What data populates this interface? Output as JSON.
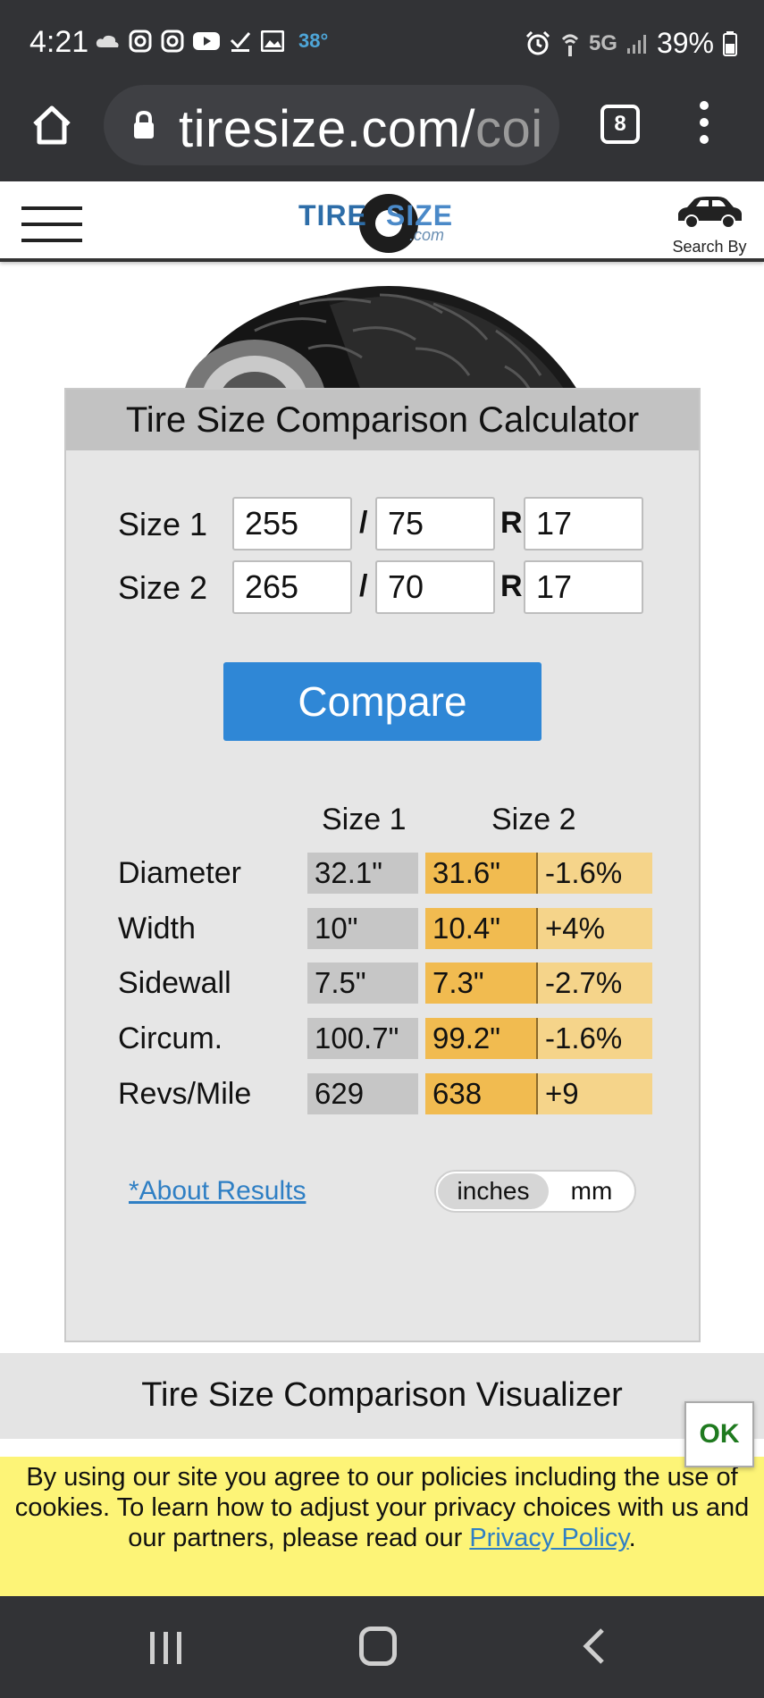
{
  "status_bar": {
    "time": "4:21",
    "temperature": "38°",
    "network": "5G",
    "battery": "39%"
  },
  "browser": {
    "url_main": "tiresize.com/",
    "url_dim": "coi",
    "tab_count": "8"
  },
  "site_header": {
    "logo_left": "TIRE",
    "logo_right": "SIZE",
    "logo_suffix": ".com",
    "search_by": "Search By"
  },
  "calculator": {
    "title": "Tire Size Comparison Calculator",
    "size1": {
      "label": "Size 1",
      "width": "255",
      "ratio": "75",
      "rim": "17"
    },
    "size2": {
      "label": "Size 2",
      "width": "265",
      "ratio": "70",
      "rim": "17"
    },
    "separator": "/",
    "rim_prefix": "R",
    "compare_label": "Compare",
    "results": {
      "header_size1": "Size 1",
      "header_size2": "Size 2",
      "rows": [
        {
          "label": "Diameter",
          "size1": "32.1\"",
          "size2": "31.6\"",
          "diff": "-1.6%"
        },
        {
          "label": "Width",
          "size1": "10\"",
          "size2": "10.4\"",
          "diff": "+4%"
        },
        {
          "label": "Sidewall",
          "size1": "7.5\"",
          "size2": "7.3\"",
          "diff": "-2.7%"
        },
        {
          "label": "Circum.",
          "size1": "100.7\"",
          "size2": "99.2\"",
          "diff": "-1.6%"
        },
        {
          "label": "Revs/Mile",
          "size1": "629",
          "size2": "638",
          "diff": "+9"
        }
      ]
    },
    "about_link": "*About Results",
    "unit_inches": "inches",
    "unit_mm": "mm",
    "selected_unit": "inches"
  },
  "visualizer": {
    "title": "Tire Size Comparison Visualizer"
  },
  "cookie_banner": {
    "text_before_link": "By using our site you agree to our policies including the use of cookies. To learn how to adjust your privacy choices with us and our partners, please read our ",
    "link_text": "Privacy Policy",
    "text_after_link": ".",
    "ok_label": "OK"
  },
  "colors": {
    "accent_blue": "#2f87d6",
    "size1_cell": "#c6c6c6",
    "size2_cell": "#f1bb50",
    "diff_cell": "#f5d48a",
    "cookie_bg": "#fdf477"
  }
}
